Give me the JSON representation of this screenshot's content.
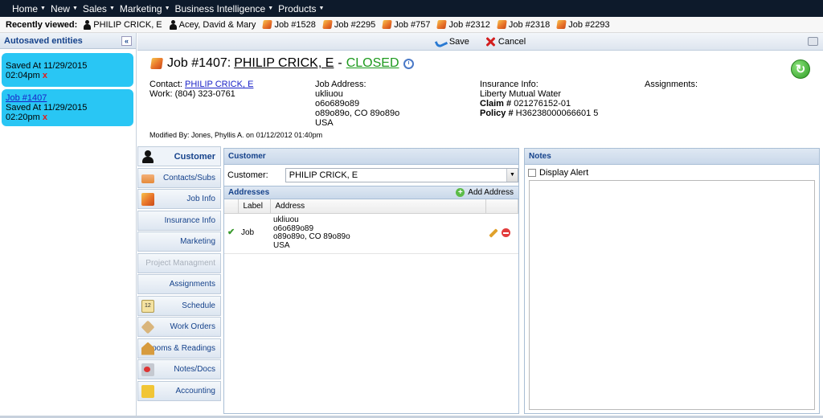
{
  "nav": {
    "items": [
      {
        "label": "Home"
      },
      {
        "label": "New"
      },
      {
        "label": "Sales"
      },
      {
        "label": "Marketing"
      },
      {
        "label": "Business Intelligence"
      },
      {
        "label": "Products"
      }
    ]
  },
  "recent": {
    "label": "Recently viewed:",
    "items": [
      {
        "label": "PHILIP CRICK, E",
        "icon": "person-icon"
      },
      {
        "label": "Acey, David & Mary",
        "icon": "person-icon"
      },
      {
        "label": "Job #1528",
        "icon": "job-icon"
      },
      {
        "label": "Job #2295",
        "icon": "job-icon"
      },
      {
        "label": "Job #757",
        "icon": "job-icon"
      },
      {
        "label": "Job #2312",
        "icon": "job-icon"
      },
      {
        "label": "Job #2318",
        "icon": "job-icon"
      },
      {
        "label": "Job #2293",
        "icon": "job-icon"
      }
    ]
  },
  "autosave": {
    "title": "Autosaved entities",
    "collapse": "«",
    "entries": [
      {
        "link": "",
        "text": "Saved At 11/29/2015 02:04pm",
        "x": "x"
      },
      {
        "link": "Job #1407",
        "text": "Saved At 11/29/2015 02:20pm",
        "x": "x"
      }
    ]
  },
  "toolbar": {
    "save": "Save",
    "cancel": "Cancel"
  },
  "job": {
    "title": "Job #1407:",
    "customer": "PHILIP CRICK, E",
    "dash": "-",
    "status": "CLOSED",
    "status_color": "#1e9a1e",
    "refresh": "↻"
  },
  "contact": {
    "label": "Contact:",
    "name": "PHILIP CRICK, E",
    "work": "Work: (804) 323-0761"
  },
  "job_address": {
    "label": "Job Address:",
    "line1": "ukliuou",
    "line2": "o6o689o89",
    "line3": "o89o89o, CO 89o89o",
    "line4": "USA"
  },
  "insurance": {
    "label": "Insurance Info:",
    "company": "Liberty Mutual Water",
    "claim_label": "Claim #",
    "claim": "021276152-01",
    "policy_label": "Policy #",
    "policy": "H36238000066601 5"
  },
  "assignments_label": "Assignments:",
  "modified": "Modified By: Jones, Phyllis A. on 01/12/2012 01:40pm",
  "tabs": [
    {
      "label": "Customer"
    },
    {
      "label": "Contacts/Subs"
    },
    {
      "label": "Job Info"
    },
    {
      "label": "Insurance Info"
    },
    {
      "label": "Marketing"
    },
    {
      "label": "Project Managment"
    },
    {
      "label": "Assignments"
    },
    {
      "label": "Schedule"
    },
    {
      "label": "Work Orders"
    },
    {
      "label": "Rooms & Readings"
    },
    {
      "label": "Notes/Docs"
    },
    {
      "label": "Accounting"
    }
  ],
  "customer_panel": {
    "title": "Customer",
    "field_label": "Customer:",
    "field_value": "PHILIP CRICK, E",
    "addresses_title": "Addresses",
    "add_address": "Add Address",
    "columns": [
      "Label",
      "Address"
    ],
    "rows": [
      {
        "label": "Job",
        "line1": "ukliuou",
        "line2": "o6o689o89",
        "line3": "o89o89o, CO 89o89o",
        "line4": "USA"
      }
    ]
  },
  "notes_panel": {
    "title": "Notes",
    "display_alert": "Display Alert"
  }
}
